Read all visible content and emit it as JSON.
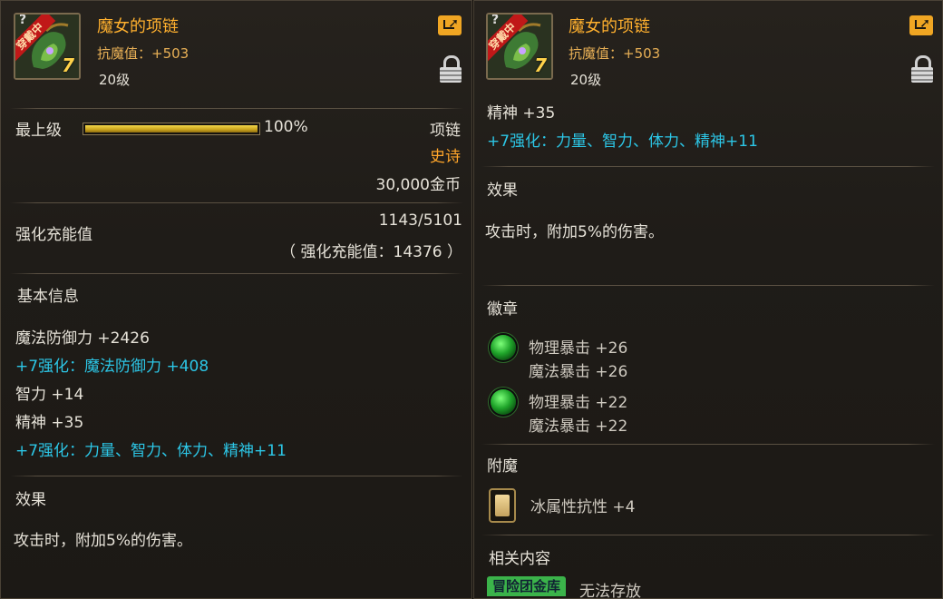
{
  "left": {
    "item_name": "魔女的项链",
    "magic_resist": "抗魔值：+503",
    "level": "20级",
    "icon_badge": "穿戴中",
    "icon_corner": "?",
    "icon_level": "7",
    "top_level_label": "最上级",
    "progress_percent": 100,
    "progress_text": "100%",
    "item_type": "项链",
    "rarity": "史诗",
    "price": "30,000金币",
    "charge_label": "强化充能值",
    "charge_value": "1143/5101",
    "charge_total": "（ 强化充能值：14376 ）",
    "basic_info_title": "基本信息",
    "stats": [
      {
        "text": "魔法防御力 +2426",
        "color": "normal"
      },
      {
        "text": "+7强化：魔法防御力 +408",
        "color": "cyan"
      },
      {
        "text": "智力 +14",
        "color": "normal"
      },
      {
        "text": "精神 +35",
        "color": "normal"
      },
      {
        "text": "+7强化：力量、智力、体力、精神+11",
        "color": "cyan"
      }
    ],
    "effect_title": "效果",
    "effect_text": "攻击时，附加5%的伤害。"
  },
  "right": {
    "item_name": "魔女的项链",
    "magic_resist": "抗魔值：+503",
    "level": "20级",
    "icon_badge": "穿戴中",
    "icon_corner": "?",
    "icon_level": "7",
    "stats": [
      {
        "text": "精神 +35",
        "color": "normal"
      },
      {
        "text": "+7强化：力量、智力、体力、精神+11",
        "color": "cyan"
      }
    ],
    "effect_title": "效果",
    "effect_text": "攻击时，附加5%的伤害。",
    "emblem_title": "徽章",
    "emblems": [
      {
        "line1": "物理暴击 +26",
        "line2": "魔法暴击 +26"
      },
      {
        "line1": "物理暴击 +22",
        "line2": "魔法暴击 +22"
      }
    ],
    "enchant_title": "附魔",
    "enchant_text": "冰属性抗性 +4",
    "related_title": "相关内容",
    "related_tag": "冒险团金库",
    "related_text": "无法存放"
  },
  "colors": {
    "title": "#ffb02e",
    "cyan": "#2cc6e6",
    "epic": "#ffa52a",
    "share": "#f0a623"
  },
  "icons": [
    "share-icon",
    "lock-icon",
    "gem-icon",
    "enchant-card-icon"
  ]
}
